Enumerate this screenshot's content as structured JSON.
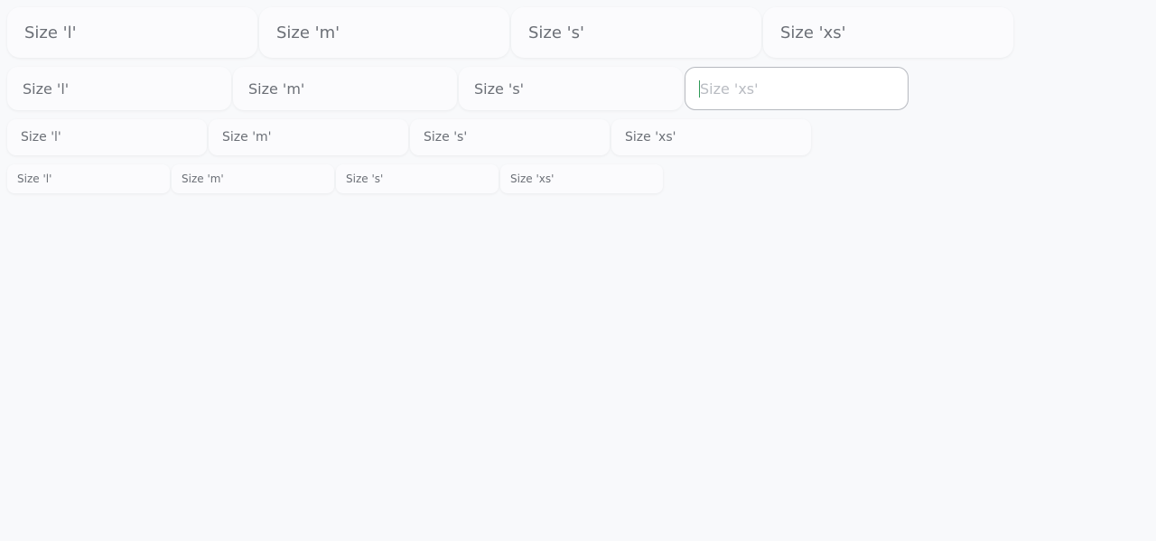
{
  "rows": [
    {
      "size": "l",
      "inputs": [
        {
          "placeholder": "Size 'l'",
          "value": ""
        },
        {
          "placeholder": "Size 'm'",
          "value": ""
        },
        {
          "placeholder": "Size 's'",
          "value": ""
        },
        {
          "placeholder": "Size 'xs'",
          "value": ""
        }
      ]
    },
    {
      "size": "m",
      "inputs": [
        {
          "placeholder": "Size 'l'",
          "value": ""
        },
        {
          "placeholder": "Size 'm'",
          "value": ""
        },
        {
          "placeholder": "Size 's'",
          "value": ""
        },
        {
          "placeholder": "Size 'xs'",
          "value": "",
          "focused": true
        }
      ]
    },
    {
      "size": "s",
      "inputs": [
        {
          "placeholder": "Size 'l'",
          "value": ""
        },
        {
          "placeholder": "Size 'm'",
          "value": ""
        },
        {
          "placeholder": "Size 's'",
          "value": ""
        },
        {
          "placeholder": "Size 'xs'",
          "value": ""
        }
      ]
    },
    {
      "size": "xs",
      "inputs": [
        {
          "placeholder": "Size 'l'",
          "value": ""
        },
        {
          "placeholder": "Size 'm'",
          "value": ""
        },
        {
          "placeholder": "Size 's'",
          "value": ""
        },
        {
          "placeholder": "Size 'xs'",
          "value": ""
        }
      ]
    }
  ],
  "colors": {
    "background": "#f8f9fb",
    "field_background": "#fbfbfd",
    "placeholder_text": "#6b6f76",
    "focused_border": "#b6b9bf",
    "caret": "#2f9a57"
  }
}
